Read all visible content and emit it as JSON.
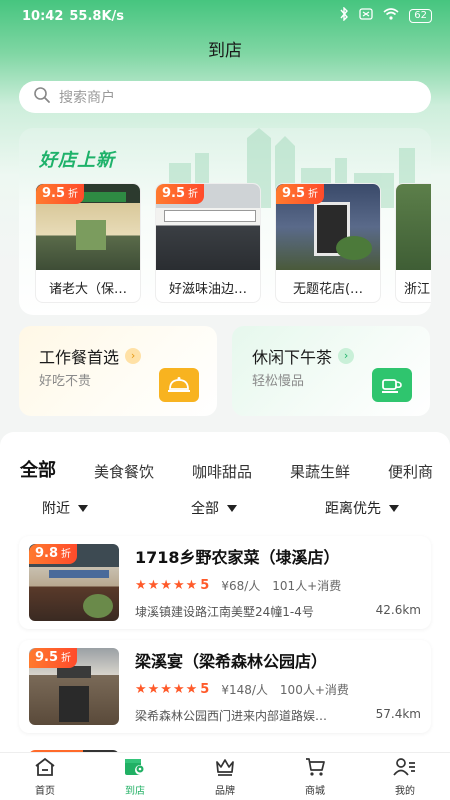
{
  "status_bar": {
    "time": "10:42",
    "speed": "55.8K/s",
    "battery": "62"
  },
  "header": {
    "title": "到店"
  },
  "search": {
    "placeholder": "搜索商户"
  },
  "promo": {
    "title": "好店上新",
    "stores": [
      {
        "discount": "9.5",
        "discount_unit": "折",
        "name": "诸老大（保…"
      },
      {
        "discount": "9.5",
        "discount_unit": "折",
        "name": "好滋味油边…"
      },
      {
        "discount": "9.5",
        "discount_unit": "折",
        "name": "无题花店(…"
      },
      {
        "name": "浙江"
      }
    ]
  },
  "categories": [
    {
      "title": "工作餐首选",
      "subtitle": "好吃不贵",
      "icon": "food-cloche-icon"
    },
    {
      "title": "休闲下午茶",
      "subtitle": "轻松慢品",
      "icon": "coffee-cup-icon"
    }
  ],
  "tabs": [
    "全部",
    "美食餐饮",
    "咖啡甜品",
    "果蔬生鲜",
    "便利商"
  ],
  "filters": {
    "nearby": "附近",
    "all": "全部",
    "sort": "距离优先"
  },
  "shops": [
    {
      "discount": "9.8",
      "discount_unit": "折",
      "name": "1718乡野农家菜（埭溪店）",
      "stars": "★★★★★",
      "score": "5",
      "price": "¥68/人",
      "consumers": "101人+消费",
      "address": "埭溪镇建设路江南美墅24幢1-4号",
      "distance": "42.6km"
    },
    {
      "discount": "9.5",
      "discount_unit": "折",
      "name": "梁溪宴（梁希森林公园店）",
      "stars": "★★★★★",
      "score": "5",
      "price": "¥148/人",
      "consumers": "100人+消费",
      "address": "梁希森林公园西门进来内部道路娱…",
      "distance": "57.4km"
    }
  ],
  "bottom_nav": [
    {
      "label": "首页",
      "icon": "home-icon"
    },
    {
      "label": "到店",
      "icon": "store-location-icon"
    },
    {
      "label": "品牌",
      "icon": "crown-icon"
    },
    {
      "label": "商城",
      "icon": "cart-icon"
    },
    {
      "label": "我的",
      "icon": "profile-icon"
    }
  ],
  "colors": {
    "brand_green": "#21b064",
    "discount_orange": "#ff5a2a",
    "lunch_yellow": "#f8b320"
  }
}
